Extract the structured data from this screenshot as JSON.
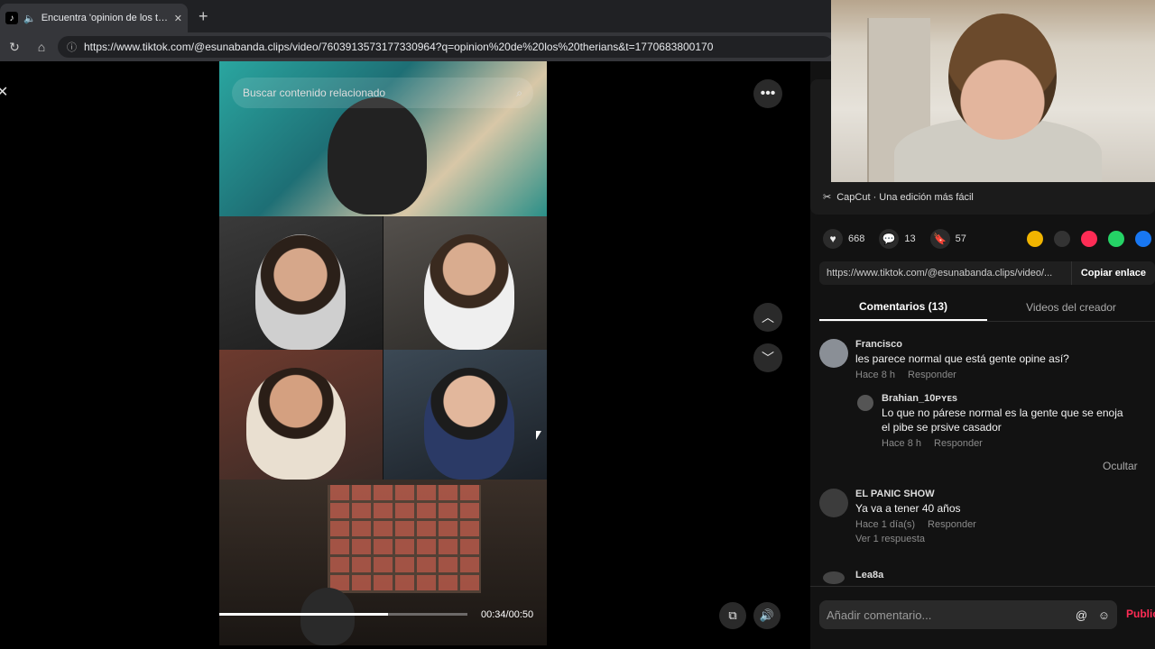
{
  "browser": {
    "tab_title": "Encuentra 'opinion de los therians'",
    "tab_close": "✕",
    "new_tab": "+",
    "url": "https://www.tiktok.com/@esunabanda.clips/video/7603913573177330964?q=opinion%20de%20los%20therians&t=1770683800170"
  },
  "video": {
    "search_placeholder": "Buscar contenido relacionado",
    "time": "00:34/00:50",
    "progress": 0.68
  },
  "side": {
    "capcut": "CapCut · Una edición más fácil",
    "likes": "668",
    "comments": "13",
    "saves": "57",
    "link_url": "https://www.tiktok.com/@esunabanda.clips/video/...",
    "copy_link": "Copiar enlace",
    "tab_comments": "Comentarios (13)",
    "tab_creator": "Videos del creador"
  },
  "comments": [
    {
      "name": "Francisco",
      "text": "les parece normal que está gente opine así?",
      "time": "Hace 8 h",
      "reply": "Responder"
    },
    {
      "name": "Brahian_10ᴘʏᴇs",
      "text": "Lo que no párese normal es la gente que se enoja el pibe se prsive casador",
      "time": "Hace 8 h",
      "reply": "Responder"
    },
    {
      "name": "EL PANIC SHOW",
      "text": "Ya va a tener 40 años",
      "time": "Hace 1 día(s)",
      "reply": "Responder"
    },
    {
      "name": "Lea8a",
      "text": "",
      "time": "",
      "reply": ""
    }
  ],
  "hide": "Ocultar",
  "see_replies": "Ver 1 respuesta",
  "input_placeholder": "Añadir comentario...",
  "post": "Publicar"
}
